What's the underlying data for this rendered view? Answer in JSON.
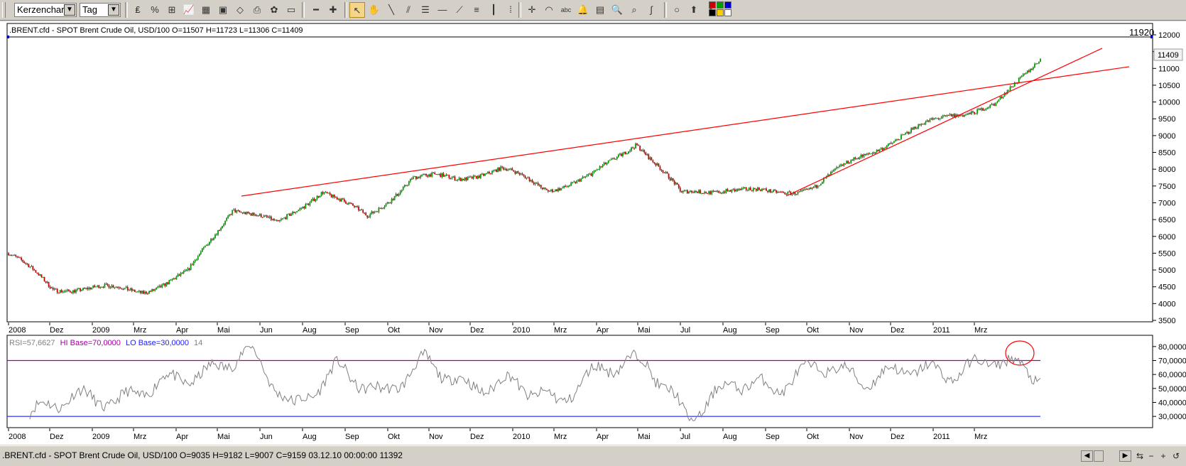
{
  "toolbar": {
    "chart_type": "Kerzenchart",
    "period": "Tag",
    "tools": [
      {
        "name": "currency-icon",
        "glyph": "₤"
      },
      {
        "name": "percent-icon",
        "glyph": "%"
      },
      {
        "name": "grid-settings-icon",
        "glyph": "⊞"
      },
      {
        "name": "chart-icon",
        "glyph": "📈"
      },
      {
        "name": "table-icon",
        "glyph": "▦"
      },
      {
        "name": "picture-icon",
        "glyph": "▣"
      },
      {
        "name": "eraser-icon",
        "glyph": "◇"
      },
      {
        "name": "printer-icon",
        "glyph": "⎙"
      },
      {
        "name": "palette-icon",
        "glyph": "✿"
      },
      {
        "name": "monitor-icon",
        "glyph": "▭"
      },
      {
        "name": "minus-icon",
        "glyph": "━"
      },
      {
        "name": "plus-icon",
        "glyph": "✚"
      },
      {
        "name": "pointer-icon",
        "glyph": "↖"
      },
      {
        "name": "hand-icon",
        "glyph": "✋"
      },
      {
        "name": "line-icon",
        "glyph": "╲"
      },
      {
        "name": "parallel-lines-icon",
        "glyph": "⫽"
      },
      {
        "name": "fibonacci-icon",
        "glyph": "☰"
      },
      {
        "name": "hline-icon",
        "glyph": "—"
      },
      {
        "name": "fan-icon",
        "glyph": "⟋"
      },
      {
        "name": "color-lines-icon",
        "glyph": "≡"
      },
      {
        "name": "candle-icon",
        "glyph": "┃"
      },
      {
        "name": "dotted-grid-icon",
        "glyph": "⁞"
      },
      {
        "name": "crosshair-icon",
        "glyph": "✛"
      },
      {
        "name": "arc-icon",
        "glyph": "◠"
      },
      {
        "name": "text-tool-icon",
        "glyph": "abc"
      },
      {
        "name": "bell-icon",
        "glyph": "🔔"
      },
      {
        "name": "calculator-icon",
        "glyph": "▤"
      },
      {
        "name": "zoom-icon",
        "glyph": "🔍"
      },
      {
        "name": "zoom-box-icon",
        "glyph": "⌕"
      },
      {
        "name": "wave-icon",
        "glyph": "∫"
      },
      {
        "name": "circle-icon",
        "glyph": "○"
      },
      {
        "name": "arrow-up-icon",
        "glyph": "⬆"
      },
      {
        "name": "arrow-down-icon",
        "glyph": "⬇"
      }
    ],
    "swatch_colors": [
      "#cc0000",
      "#00a000",
      "#0000cc",
      "#000000",
      "#ffcc00",
      "#ffffff"
    ]
  },
  "price_panel": {
    "header": ".BRENT.cfd - SPOT Brent Crude Oil, USD/100 O=11507 H=11723 L=11306 C=11409",
    "high_label": "11920",
    "last_label": "11409",
    "y_ticks": [
      "12000",
      "11500",
      "11000",
      "10500",
      "10000",
      "9500",
      "9000",
      "8500",
      "8000",
      "7500",
      "7000",
      "6500",
      "6000",
      "5500",
      "5000",
      "4500",
      "4000",
      "3500"
    ],
    "x_labels": [
      "2008",
      "Dez",
      "2009",
      "Mrz",
      "Apr",
      "Mai",
      "Jun",
      "Aug",
      "Sep",
      "Okt",
      "Nov",
      "Dez",
      "2010",
      "Mrz",
      "Apr",
      "Mai",
      "Jul",
      "Aug",
      "Sep",
      "Okt",
      "Nov",
      "Dez",
      "2011",
      "Mrz"
    ],
    "colors": {
      "up": "#00a000",
      "down": "#cc0000",
      "trendline": "#ff0000",
      "frame": "#000000"
    }
  },
  "rsi_panel": {
    "label_rsi": "RSI=57,6627",
    "label_hi": "HI Base=70,0000",
    "label_lo": "LO Base=30,0000",
    "label_period": "14",
    "y_ticks": [
      "80,0000",
      "70,0000",
      "60,0000",
      "50,0000",
      "40,0000",
      "30,0000"
    ],
    "x_labels": [
      "2008",
      "Dez",
      "2009",
      "Mrz",
      "Apr",
      "Mai",
      "Jun",
      "Aug",
      "Sep",
      "Okt",
      "Nov",
      "Dez",
      "2010",
      "Mrz",
      "Apr",
      "Mai",
      "Jul",
      "Aug",
      "Sep",
      "Okt",
      "Nov",
      "Dez",
      "2011",
      "Mrz"
    ],
    "colors": {
      "line": "#808080",
      "hi": "#a000a0",
      "lo": "#2020ff",
      "circle": "#ff0000"
    }
  },
  "status": {
    "text": ".BRENT.cfd - SPOT Brent Crude Oil, USD/100 O=9035 H=9182 L=9007 C=9159   03.12.10 00:00:00 11392"
  },
  "chart_data": [
    {
      "type": "line",
      "title": ".BRENT.cfd - SPOT Brent Crude Oil, USD/100 O=11507 H=11723 L=11306 C=11409",
      "x": [
        "2008",
        "Dez",
        "2009",
        "Mrz",
        "Apr",
        "Mai",
        "Jun",
        "Aug",
        "Sep",
        "Okt",
        "Nov",
        "Dez",
        "2010",
        "Mrz",
        "Apr",
        "Mai",
        "Jul",
        "Aug",
        "Sep",
        "Okt",
        "Nov",
        "Dez",
        "2011",
        "Mrz"
      ],
      "close_approx": [
        5500,
        4300,
        4400,
        4500,
        5000,
        6800,
        6200,
        7400,
        6700,
        7800,
        7600,
        7900,
        7500,
        7900,
        8800,
        7100,
        7400,
        7400,
        7600,
        8300,
        8900,
        9700,
        10000,
        11400
      ],
      "ylim": [
        3500,
        12000
      ],
      "trendlines": [
        {
          "x1": "Mai 2009",
          "y1": 7200,
          "x2": "Mrz 2011+",
          "y2": 11200
        },
        {
          "x1": "Aug 2010",
          "y1": 7200,
          "x2": "Mrz 2011+",
          "y2": 11500
        }
      ]
    },
    {
      "type": "line",
      "title": "RSI=57,6627 HI Base=70,0000 LO Base=30,0000 14",
      "x": [
        "2008",
        "Dez",
        "2009",
        "Mrz",
        "Apr",
        "Mai",
        "Jun",
        "Aug",
        "Sep",
        "Okt",
        "Nov",
        "Dez",
        "2010",
        "Mrz",
        "Apr",
        "Mai",
        "Jul",
        "Aug",
        "Sep",
        "Okt",
        "Nov",
        "Dez",
        "2011",
        "Mrz"
      ],
      "values_approx": [
        32,
        45,
        40,
        55,
        60,
        78,
        35,
        65,
        45,
        70,
        50,
        55,
        40,
        65,
        70,
        28,
        55,
        50,
        68,
        55,
        65,
        60,
        72,
        58
      ],
      "hi_base": 70,
      "lo_base": 30,
      "ylim": [
        25,
        85
      ]
    }
  ]
}
